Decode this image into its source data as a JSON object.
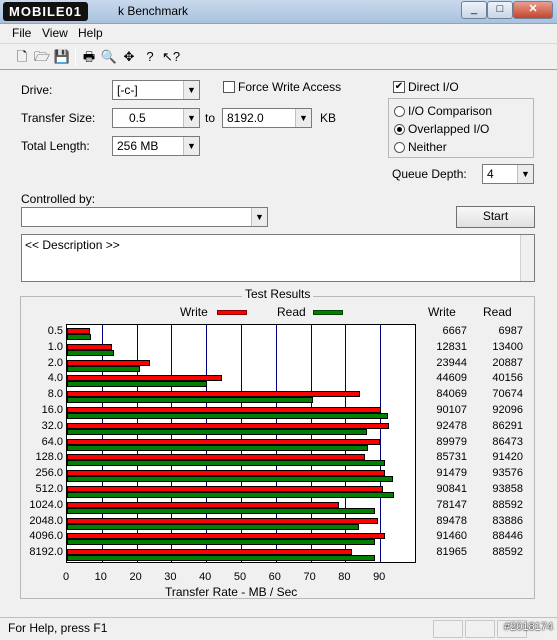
{
  "window": {
    "logo_text": "MOBILE01",
    "title": "k Benchmark",
    "minimize": "_",
    "maximize": "□",
    "close": "✕"
  },
  "menu": [
    "File",
    "View",
    "Help"
  ],
  "toolbar": {
    "icons": [
      "new-file-icon",
      "open-folder-icon",
      "save-icon",
      "print-icon",
      "print-preview-icon",
      "move-icon",
      "help-icon",
      "context-help-icon"
    ],
    "glyphs": [
      "🗋",
      "🗁",
      "💾",
      "🖶",
      "🔍",
      "✥",
      "?",
      "↖?"
    ]
  },
  "settings": {
    "drive_label": "Drive:",
    "drive_value": "[-c-]",
    "force_write_label": "Force Write Access",
    "force_write_checked": false,
    "direct_io_label": "Direct I/O",
    "direct_io_checked": true,
    "transfer_size_label": "Transfer Size:",
    "transfer_from": "0.5",
    "to_label": "to",
    "transfer_to": "8192.0",
    "kb_label": "KB",
    "total_length_label": "Total Length:",
    "total_length_value": "256 MB",
    "io_comparison_label": "I/O Comparison",
    "overlapped_io_label": "Overlapped I/O",
    "neither_label": "Neither",
    "selected_mode": "Overlapped I/O",
    "queue_depth_label": "Queue Depth:",
    "queue_depth_value": "4",
    "controlled_by_label": "Controlled by:",
    "controlled_by_value": "",
    "start_label": "Start",
    "description": "<< Description >>"
  },
  "results": {
    "title": "Test Results",
    "write_legend": "Write",
    "read_legend": "Read",
    "write_col": "Write",
    "read_col": "Read",
    "write_color": "#ff0000",
    "read_color": "#008000"
  },
  "chart_data": {
    "type": "bar",
    "orientation": "horizontal",
    "xlabel": "Transfer Rate - MB / Sec",
    "xlim": [
      0,
      100
    ],
    "xticks": [
      "0",
      "10",
      "20",
      "30",
      "40",
      "50",
      "60",
      "70",
      "80",
      "90"
    ],
    "grid": true,
    "legend": "top",
    "categories": [
      "0.5",
      "1.0",
      "2.0",
      "4.0",
      "8.0",
      "16.0",
      "32.0",
      "64.0",
      "128.0",
      "256.0",
      "512.0",
      "1024.0",
      "2048.0",
      "4096.0",
      "8192.0"
    ],
    "series": [
      {
        "name": "Write",
        "values": [
          6.7,
          12.8,
          23.9,
          44.6,
          84.1,
          90.1,
          92.5,
          90.0,
          85.7,
          91.5,
          90.8,
          78.1,
          89.5,
          91.5,
          82.0
        ]
      },
      {
        "name": "Read",
        "values": [
          7.0,
          13.4,
          20.9,
          40.2,
          70.7,
          92.1,
          86.3,
          86.5,
          91.4,
          93.6,
          93.9,
          88.6,
          83.9,
          88.4,
          88.6
        ]
      }
    ],
    "write_kb": [
      "6667",
      "12831",
      "23944",
      "44609",
      "84069",
      "90107",
      "92478",
      "89979",
      "85731",
      "91479",
      "90841",
      "78147",
      "89478",
      "91460",
      "81965"
    ],
    "read_kb": [
      "6987",
      "13400",
      "20887",
      "40156",
      "70674",
      "92096",
      "86291",
      "86473",
      "91420",
      "93576",
      "93858",
      "88592",
      "83886",
      "88446",
      "88592"
    ]
  },
  "status": {
    "text": "For Help, press F1",
    "watermark": "#2018174"
  }
}
